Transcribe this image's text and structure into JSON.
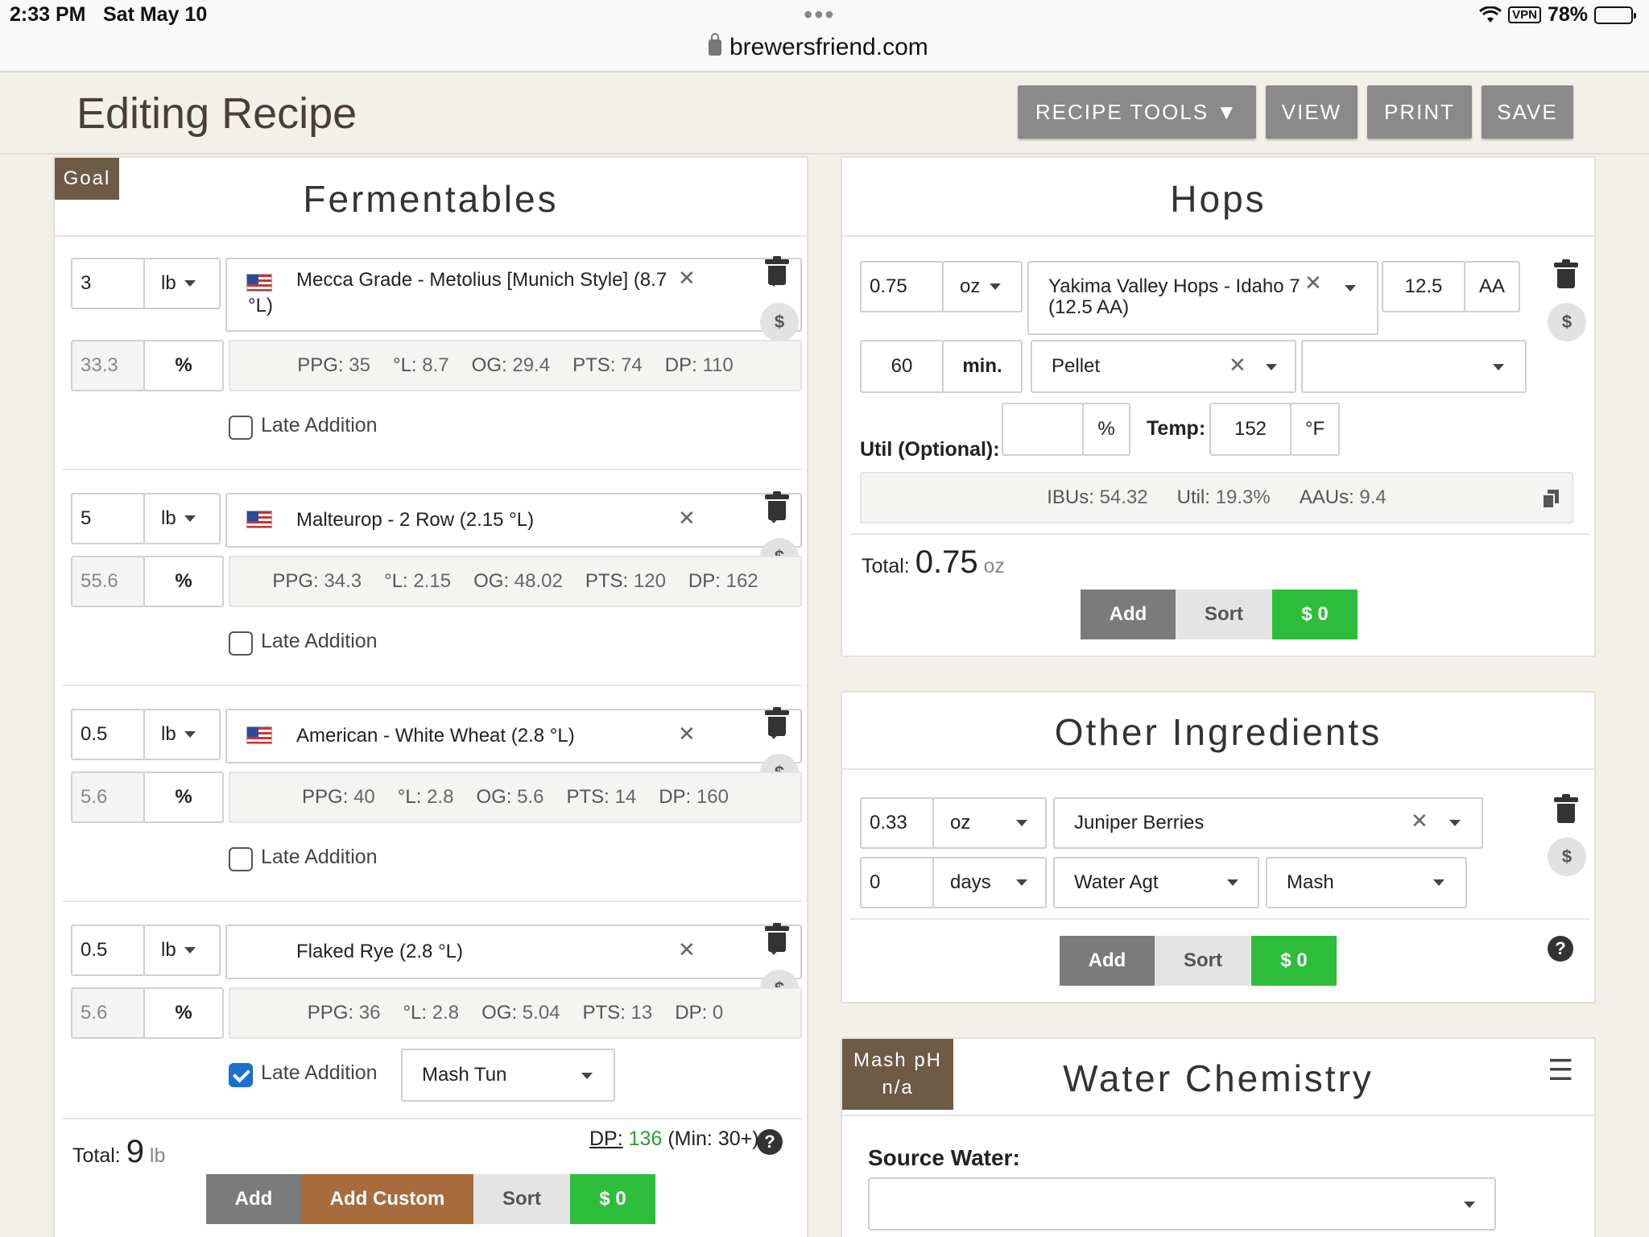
{
  "status_bar": {
    "time": "2:33 PM",
    "date": "Sat May 10",
    "dots": "•••",
    "url": "brewersfriend.com",
    "vpn": "VPN",
    "battery": "78%",
    "battery_level": 0.78
  },
  "header": {
    "title": "Editing Recipe",
    "buttons": {
      "recipe_tools": "RECIPE TOOLS ▼",
      "view": "VIEW",
      "print": "PRINT",
      "save": "SAVE"
    }
  },
  "fermentables": {
    "goal_tag": "Goal",
    "title": "Fermentables",
    "items": [
      {
        "amount": "3",
        "unit": "lb",
        "name_line1": "Mecca Grade - Metolius [Munich Style] (8.7",
        "name_line2": "°L)",
        "percent": "33.3",
        "pct_symbol": "%",
        "ppg": "35",
        "lov": "8.7",
        "og": "29.4",
        "pts": "74",
        "dp": "110",
        "late_label": "Late Addition",
        "late": false,
        "flag": true
      },
      {
        "amount": "5",
        "unit": "lb",
        "name_line1": "Malteurop - 2 Row (2.15 °L)",
        "name_line2": "",
        "percent": "55.6",
        "pct_symbol": "%",
        "ppg": "34.3",
        "lov": "2.15",
        "og": "48.02",
        "pts": "120",
        "dp": "162",
        "late_label": "Late Addition",
        "late": false,
        "flag": true
      },
      {
        "amount": "0.5",
        "unit": "lb",
        "name_line1": "American - White Wheat (2.8 °L)",
        "name_line2": "",
        "percent": "5.6",
        "pct_symbol": "%",
        "ppg": "40",
        "lov": "2.8",
        "og": "5.6",
        "pts": "14",
        "dp": "160",
        "late_label": "Late Addition",
        "late": false,
        "flag": true
      },
      {
        "amount": "0.5",
        "unit": "lb",
        "name_line1": "Flaked Rye (2.8 °L)",
        "name_line2": "",
        "percent": "5.6",
        "pct_symbol": "%",
        "ppg": "36",
        "lov": "2.8",
        "og": "5.04",
        "pts": "13",
        "dp": "0",
        "late_label": "Late Addition",
        "late": true,
        "late_stage": "Mash Tun",
        "flag": false
      }
    ],
    "labels": {
      "ppg": "PPG:",
      "lov": "°L:",
      "og": "OG:",
      "pts": "PTS:",
      "dp": "DP:"
    },
    "total_label": "Total:",
    "total_value": "9",
    "total_unit": "lb",
    "dp_label": "DP:",
    "dp_value": "136",
    "dp_min": "(Min: 30+)",
    "buttons": {
      "add": "Add",
      "add_custom": "Add Custom",
      "sort": "Sort",
      "money": "$ 0"
    }
  },
  "hops": {
    "title": "Hops",
    "amount": "0.75",
    "unit": "oz",
    "name_line1": "Yakima Valley Hops - Idaho 7",
    "name_line2": "(12.5 AA)",
    "aa_value": "12.5",
    "aa_label": "AA",
    "time": "60",
    "time_unit": "min.",
    "form": "Pellet",
    "use": "",
    "util_label": "Util (Optional):",
    "util_value": "",
    "util_unit": "%",
    "temp_label": "Temp:",
    "temp_value": "152",
    "temp_unit": "°F",
    "ibus_label": "IBUs:",
    "ibus": "54.32",
    "util_res_label": "Util:",
    "util_res": "19.3%",
    "aaus_label": "AAUs:",
    "aaus": "9.4",
    "total_label": "Total:",
    "total_value": "0.75",
    "total_unit": "oz",
    "buttons": {
      "add": "Add",
      "sort": "Sort",
      "money": "$ 0"
    }
  },
  "other": {
    "title": "Other Ingredients",
    "amount": "0.33",
    "unit": "oz",
    "name": "Juniper Berries",
    "time": "0",
    "time_unit": "days",
    "type": "Water Agt",
    "use": "Mash",
    "buttons": {
      "add": "Add",
      "sort": "Sort",
      "money": "$ 0"
    }
  },
  "water": {
    "tag_line1": "Mash pH",
    "tag_line2": "n/a",
    "title": "Water Chemistry",
    "menu_icon": "☰",
    "source_label": "Source Water:",
    "source_value": ""
  },
  "colors": {
    "tag_brown": "#6e5b45",
    "money_green": "#2ebd3a",
    "custom_brown": "#a86b3c",
    "dp_green": "#2e9e2e"
  }
}
